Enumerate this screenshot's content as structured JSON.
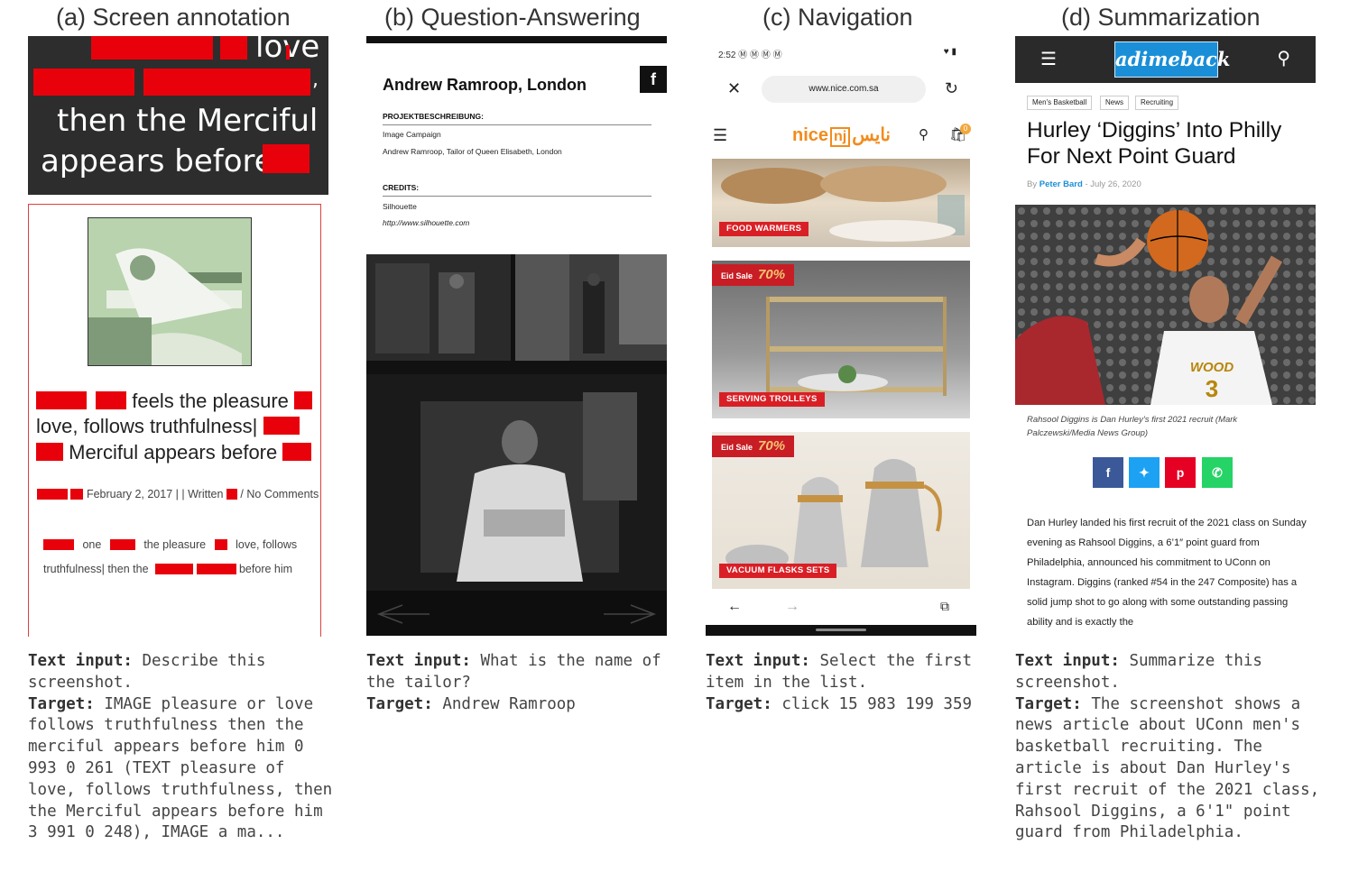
{
  "panels": {
    "a": {
      "title": "(a) Screen annotation"
    },
    "b": {
      "title": "(b) Question-Answering"
    },
    "c": {
      "title": "(c) Navigation"
    },
    "d": {
      "title": "(d) Summarization"
    }
  },
  "panel_a": {
    "top": {
      "line1": "love",
      "line2": ",",
      "line3": "then the Merciful",
      "line4": "appears before"
    },
    "card": {
      "line1": "feels the pleasure",
      "line2": "love, follows truthfulness|",
      "line3": "Merciful appears before",
      "meta_date": "February 2, 2017 | | Written",
      "meta_comments": "/ No Comments",
      "para1_a": "one",
      "para1_b": "the pleasure",
      "para1_c": "love, follows",
      "para2_a": "truthfulness| then the",
      "para2_b": "before him"
    },
    "caption_input_label": "Text input:",
    "caption_input": "Describe this screenshot.",
    "caption_target_label": "Target:",
    "caption_target": "IMAGE pleasure or love follows truthfulness then the merciful appears before him 0 993 0 261 (TEXT pleasure of love, follows truthfulness, then the Merciful appears before him 3 991 0 248), IMAGE a ma..."
  },
  "panel_b": {
    "name": "Andrew Ramroop, London",
    "fb": "f",
    "sec1": "PROJEKTBESCHREIBUNG:",
    "sec1_line1": "Image Campaign",
    "sec1_line2": "Andrew Ramroop, Tailor of Queen Elisabeth, London",
    "sec2": "CREDITS:",
    "sec2_line1": "Silhouette",
    "sec2_line2": "http://www.silhouette.com",
    "caption_input_label": "Text input:",
    "caption_input": "What is the name of the tailor?",
    "caption_target_label": "Target:",
    "caption_target": "Andrew Ramroop"
  },
  "panel_c": {
    "status_time": "2:52",
    "url": "www.nice.com.sa",
    "logo_text": "nice",
    "logo_arabic": "نايس",
    "cart_count": "0",
    "cards": [
      {
        "label": "FOOD WARMERS"
      },
      {
        "label": "SERVING TROLLEYS",
        "eid": "Eid Sale",
        "pct": "70%"
      },
      {
        "label": "VACUUM FLASKS SETS",
        "eid": "Eid Sale",
        "pct": "70%"
      }
    ],
    "caption_input_label": "Text input:",
    "caption_input": "Select the first item in the list.",
    "caption_target_label": "Target:",
    "caption_target": "click 15 983 199 359"
  },
  "panel_d": {
    "logo": "adimeback",
    "tags": [
      "Men's Basketball",
      "News",
      "Recruiting"
    ],
    "title": "Hurley ‘Diggins’ Into Philly For Next Point Guard",
    "by_prefix": "By",
    "author": "Peter Bard",
    "date": "- July 26, 2020",
    "jersey": "WOOD",
    "jersey_num": "3",
    "photo_caption": "Rahsool Diggins is Dan Hurley’s first 2021 recruit (Mark Palczewski/Media News Group)",
    "body": "Dan Hurley landed his first recruit of the 2021 class on Sunday evening as Rahsool Diggins, a 6’1″ point guard from Philadelphia, announced his commitment to UConn on Instagram. Diggins (ranked #54 in the 247 Composite) has a solid jump shot to go along with some outstanding passing ability and is exactly the",
    "caption_input_label": "Text input:",
    "caption_input": "Summarize this screenshot.",
    "caption_target_label": "Target:",
    "caption_target": "The screenshot shows a news article about UConn men's basketball recruiting. The article is about Dan Hurley's first recruit of the 2021 class, Rahsool Diggins, a 6'1\" point guard from Philadelphia."
  },
  "colors": {
    "redact": "#e8000b",
    "fb": "#3b5998",
    "tw": "#1da1f2",
    "pin": "#e60023",
    "wa": "#25d366",
    "accent": "#1a8fd8"
  }
}
